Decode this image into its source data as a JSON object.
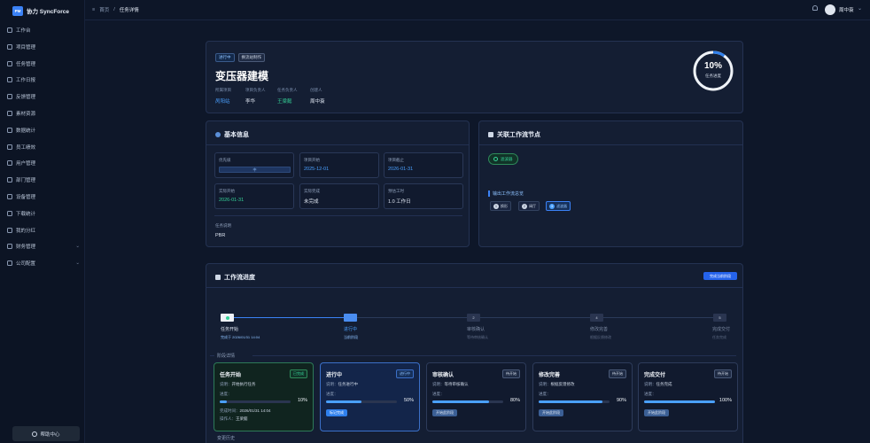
{
  "brand": {
    "logo": "PM",
    "name": "协力 SyncForce"
  },
  "sidebar": {
    "items": [
      {
        "label": "工作台",
        "icon": "dashboard-icon"
      },
      {
        "label": "项目管理",
        "icon": "folder-icon"
      },
      {
        "label": "任务管理",
        "icon": "task-icon"
      },
      {
        "label": "工作日报",
        "icon": "report-icon"
      },
      {
        "label": "反馈管理",
        "icon": "feedback-icon"
      },
      {
        "label": "素材资源",
        "icon": "asset-icon"
      },
      {
        "label": "数据统计",
        "icon": "stats-icon"
      },
      {
        "label": "员工绩效",
        "icon": "performance-icon"
      },
      {
        "label": "用户管理",
        "icon": "user-icon"
      },
      {
        "label": "部门管理",
        "icon": "department-icon"
      },
      {
        "label": "设备管理",
        "icon": "device-icon"
      },
      {
        "label": "下载统计",
        "icon": "download-icon"
      },
      {
        "label": "我的分红",
        "icon": "dividend-icon"
      },
      {
        "label": "财务管理",
        "icon": "finance-icon",
        "expandable": true
      },
      {
        "label": "公司配置",
        "icon": "company-icon",
        "expandable": true
      }
    ],
    "help_label": "帮助中心"
  },
  "topbar": {
    "breadcrumb": [
      "首页",
      "任务详情"
    ],
    "separator": "/",
    "username": "周中衰"
  },
  "task": {
    "status_badge": "进行中",
    "stage_badge": "换流站制作",
    "title": "变压器建模",
    "meta": [
      {
        "label": "所属项目",
        "value": "呙阳站",
        "tone": "blue"
      },
      {
        "label": "项目负责人",
        "value": "李华",
        "tone": "plain"
      },
      {
        "label": "任务负责人",
        "value": "王梁懿",
        "tone": "green"
      },
      {
        "label": "创建人",
        "value": "周中衰",
        "tone": "plain"
      }
    ],
    "progress_pct": 10,
    "progress_text": "10%",
    "progress_label": "任务进度"
  },
  "basic_info": {
    "title": "基本信息",
    "fields": [
      {
        "label": "优先级",
        "value": "中",
        "kind": "bar"
      },
      {
        "label": "项目开始",
        "value": "2025-12-01",
        "tone": "blue"
      },
      {
        "label": "项目截止",
        "value": "2026-01-31",
        "tone": "blue"
      },
      {
        "label": "实际开始",
        "value": "2026-01-31",
        "tone": "green"
      },
      {
        "label": "实际完成",
        "value": "未完成",
        "tone": "plain"
      },
      {
        "label": "预估工时",
        "value": "1.0 工作日",
        "tone": "plain"
      }
    ],
    "desc_label": "任务说明",
    "desc_value": "PBR"
  },
  "workflow": {
    "title": "关联工作流节点",
    "chip": "滤波器",
    "process_label": "输出工作流总览",
    "steps": [
      {
        "num": "1",
        "label": "换形"
      },
      {
        "num": "2",
        "label": "阀厅"
      },
      {
        "num": "3",
        "label": "滤波器",
        "active": true
      }
    ]
  },
  "progress_section": {
    "title": "工作流进度",
    "complete_button": "完成当前阶段",
    "current_fraction": 0.25,
    "nodes": [
      {
        "state": "done",
        "num": "",
        "name": "任务开始",
        "sub": "完成于 2026/01/31 14:04"
      },
      {
        "state": "cur",
        "num": "",
        "name": "进行中",
        "sub": "当前阶段"
      },
      {
        "state": "todo",
        "num": "2",
        "name": "审核确认",
        "sub": "等待审核确认"
      },
      {
        "state": "todo",
        "num": "4",
        "name": "修改完善",
        "sub": "根据反馈修改"
      },
      {
        "state": "todo",
        "num": "5",
        "name": "完成交付",
        "sub": "任务完成"
      }
    ],
    "stage_detail_title": "阶段详情",
    "change_history_title": "变更历史",
    "stages": [
      {
        "state": "done",
        "name": "任务开始",
        "badge": "已完成",
        "desc_key": "说明：",
        "desc": "开始执行任务",
        "progress_key": "进度：",
        "pct": 10,
        "pct_text": "10%",
        "done_time_key": "完成时间：",
        "done_time": "2026/01/31 14:04",
        "operator_key": "操作人：",
        "operator": "王梁懿"
      },
      {
        "state": "cur",
        "name": "进行中",
        "badge": "进行中",
        "desc_key": "说明：",
        "desc": "任务进行中",
        "progress_key": "进度：",
        "pct": 50,
        "pct_text": "50%",
        "button": "标记完成"
      },
      {
        "state": "todo",
        "name": "审核确认",
        "badge": "待开始",
        "desc_key": "说明：",
        "desc": "等待审核确认",
        "progress_key": "进度：",
        "pct": 80,
        "pct_text": "80%",
        "button": "开始此阶段"
      },
      {
        "state": "todo",
        "name": "修改完善",
        "badge": "待开始",
        "desc_key": "说明：",
        "desc": "根据反馈修改",
        "progress_key": "进度：",
        "pct": 90,
        "pct_text": "90%",
        "button": "开始此阶段"
      },
      {
        "state": "todo",
        "name": "完成交付",
        "badge": "待开始",
        "desc_key": "说明：",
        "desc": "任务完成",
        "progress_key": "进度：",
        "pct": 100,
        "pct_text": "100%",
        "button": "开始此阶段"
      }
    ]
  },
  "colors": {
    "accent": "#3b82f6",
    "success": "#36d399",
    "background": "#0e1729",
    "card": "#141e33"
  }
}
